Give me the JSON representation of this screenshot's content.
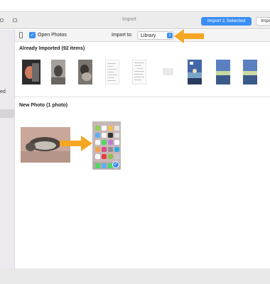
{
  "window": {
    "title": "Import"
  },
  "buttons": {
    "import_selected": "Import 1 Selected",
    "import_all": "Import All New Items"
  },
  "toolbar": {
    "open_photos_label": "Open Photos",
    "open_photos_checked": true,
    "import_to_label": "Import to:",
    "import_to_value": "Library"
  },
  "sidebar": {
    "partial_label": "ed"
  },
  "sections": {
    "already_imported": "Already Imported (92 items)",
    "new_photo": "New Photo (1 photo)"
  },
  "already_imported_items": [
    {
      "icon": "photo-cat-1"
    },
    {
      "icon": "photo-cat-2"
    },
    {
      "icon": "photo-cat-3"
    },
    {
      "icon": "screenshot-doc-1"
    },
    {
      "icon": "screenshot-doc-2"
    },
    {
      "icon": "screenshot-blank"
    },
    {
      "icon": "video-landscape"
    },
    {
      "icon": "photo-landscape-1"
    },
    {
      "icon": "photo-landscape-2"
    }
  ],
  "new_items": [
    {
      "icon": "photo-cat-lying"
    },
    {
      "icon": "screenshot-home-screen",
      "selected": true
    }
  ],
  "colors": {
    "accent": "#3a8ef5",
    "arrow": "#f5a623"
  }
}
